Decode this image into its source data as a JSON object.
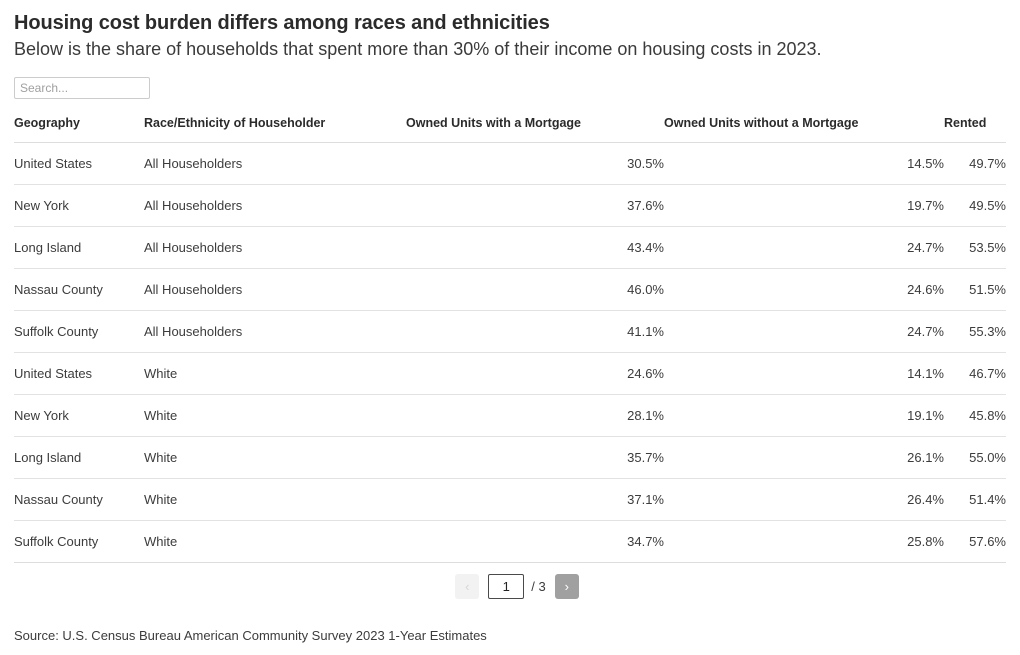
{
  "header": {
    "title": "Housing cost burden differs among races and ethnicities",
    "subtitle": "Below is the share of households that spent more than 30% of their income on housing costs in 2023."
  },
  "search": {
    "placeholder": "Search...",
    "value": ""
  },
  "table": {
    "columns": [
      "Geography",
      "Race/Ethnicity of Householder",
      "Owned Units with a Mortgage",
      "Owned Units without a Mortgage",
      "Rented"
    ],
    "rows": [
      {
        "geography": "United States",
        "race": "All Householders",
        "owned_with_mortgage": "30.5%",
        "owned_without_mortgage": "14.5%",
        "rented": "49.7%"
      },
      {
        "geography": "New York",
        "race": "All Householders",
        "owned_with_mortgage": "37.6%",
        "owned_without_mortgage": "19.7%",
        "rented": "49.5%"
      },
      {
        "geography": "Long Island",
        "race": "All Householders",
        "owned_with_mortgage": "43.4%",
        "owned_without_mortgage": "24.7%",
        "rented": "53.5%"
      },
      {
        "geography": "Nassau County",
        "race": "All Householders",
        "owned_with_mortgage": "46.0%",
        "owned_without_mortgage": "24.6%",
        "rented": "51.5%"
      },
      {
        "geography": "Suffolk County",
        "race": "All Householders",
        "owned_with_mortgage": "41.1%",
        "owned_without_mortgage": "24.7%",
        "rented": "55.3%"
      },
      {
        "geography": "United States",
        "race": "White",
        "owned_with_mortgage": "24.6%",
        "owned_without_mortgage": "14.1%",
        "rented": "46.7%"
      },
      {
        "geography": "New York",
        "race": "White",
        "owned_with_mortgage": "28.1%",
        "owned_without_mortgage": "19.1%",
        "rented": "45.8%"
      },
      {
        "geography": "Long Island",
        "race": "White",
        "owned_with_mortgage": "35.7%",
        "owned_without_mortgage": "26.1%",
        "rented": "55.0%"
      },
      {
        "geography": "Nassau County",
        "race": "White",
        "owned_with_mortgage": "37.1%",
        "owned_without_mortgage": "26.4%",
        "rented": "51.4%"
      },
      {
        "geography": "Suffolk County",
        "race": "White",
        "owned_with_mortgage": "34.7%",
        "owned_without_mortgage": "25.8%",
        "rented": "57.6%"
      }
    ]
  },
  "pagination": {
    "prev_label": "‹",
    "next_label": "›",
    "current_page": "1",
    "total_label": "/ 3",
    "prev_disabled": true
  },
  "footer": {
    "source": "Source: U.S. Census Bureau American Community Survey 2023 1-Year Estimates"
  },
  "colors": {
    "text": "#333333",
    "border": "#dddddd",
    "next_button": "#a0a0a0",
    "disabled_button": "#f2f2f2"
  }
}
